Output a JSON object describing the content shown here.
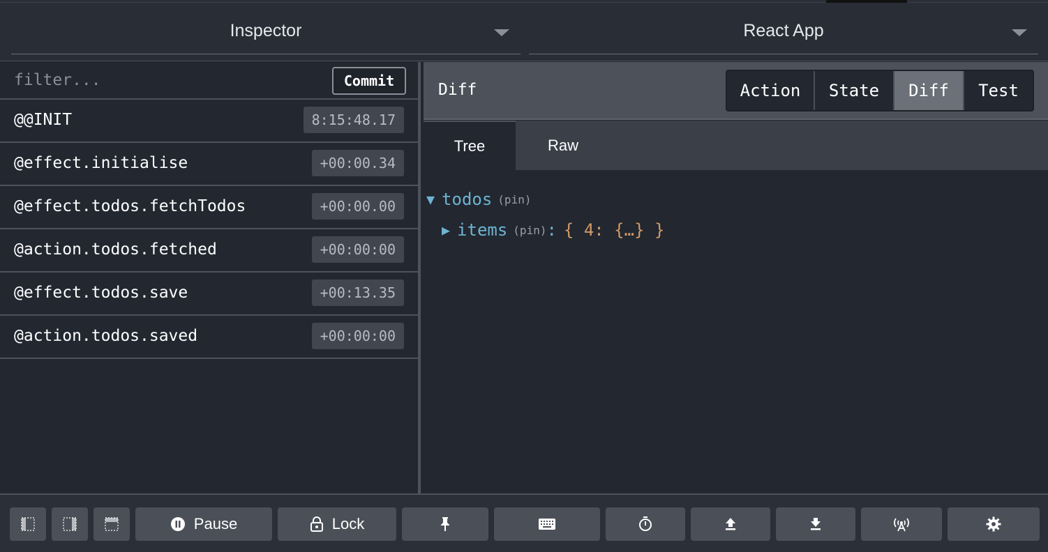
{
  "header": {
    "left_select": "Inspector",
    "right_select": "React App"
  },
  "left_pane": {
    "filter_placeholder": "filter...",
    "commit_label": "Commit",
    "actions": [
      {
        "name": "@@INIT",
        "time": "8:15:48.17"
      },
      {
        "name": "@effect.initialise",
        "time": "+00:00.34"
      },
      {
        "name": "@effect.todos.fetchTodos",
        "time": "+00:00.00"
      },
      {
        "name": "@action.todos.fetched",
        "time": "+00:00:00"
      },
      {
        "name": "@effect.todos.save",
        "time": "+00:13.35"
      },
      {
        "name": "@action.todos.saved",
        "time": "+00:00:00"
      }
    ]
  },
  "right_pane": {
    "title": "Diff",
    "tabs": [
      {
        "label": "Action",
        "active": false
      },
      {
        "label": "State",
        "active": false
      },
      {
        "label": "Diff",
        "active": true
      },
      {
        "label": "Test",
        "active": false
      }
    ],
    "subtabs": [
      {
        "label": "Tree",
        "active": true
      },
      {
        "label": "Raw",
        "active": false
      }
    ],
    "tree": {
      "root_key": "todos",
      "root_pin": "(pin)",
      "child_key": "items",
      "child_pin": "(pin)",
      "child_colon": ":",
      "child_value": "{ 4: {…} }"
    }
  },
  "toolbar": {
    "pause_label": "Pause",
    "lock_label": "Lock",
    "icons": [
      "dock-left-icon",
      "dock-bottom-icon",
      "dock-right-icon",
      "pause-icon",
      "lock-icon",
      "pin-icon",
      "keyboard-icon",
      "stopwatch-icon",
      "upload-icon",
      "download-icon",
      "remote-antenna-icon",
      "gear-icon"
    ]
  },
  "colors": {
    "background": "#222730",
    "active_tab": "#6b7079",
    "tree_key": "#6fb3d2",
    "tree_value": "#d19a66",
    "time_badge": "#41464f"
  }
}
